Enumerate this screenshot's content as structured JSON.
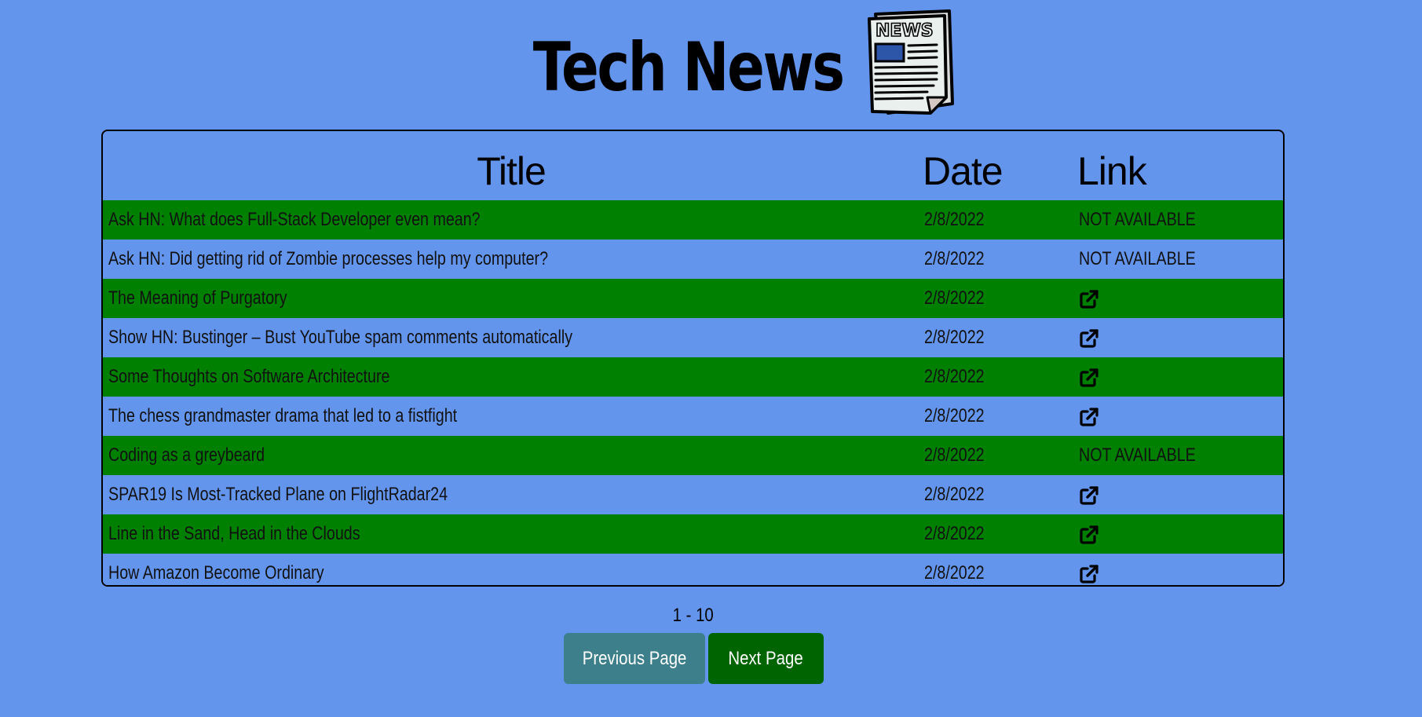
{
  "header": {
    "title": "Tech News",
    "logo_icon": "newspaper-icon",
    "logo_text": "NEWS"
  },
  "table": {
    "columns": {
      "title": "Title",
      "date": "Date",
      "link": "Link"
    },
    "not_available_text": "NOT AVAILABLE",
    "rows": [
      {
        "title": "Ask HN: What does Full-Stack Developer even mean?",
        "date": "2/8/2022",
        "link": "NOT AVAILABLE"
      },
      {
        "title": "Ask HN: Did getting rid of Zombie processes help my computer?",
        "date": "2/8/2022",
        "link": "NOT AVAILABLE"
      },
      {
        "title": "The Meaning of Purgatory",
        "date": "2/8/2022",
        "link": "external-link-icon"
      },
      {
        "title": "Show HN: Bustinger – Bust YouTube spam comments automatically",
        "date": "2/8/2022",
        "link": "external-link-icon"
      },
      {
        "title": "Some Thoughts on Software Architecture",
        "date": "2/8/2022",
        "link": "external-link-icon"
      },
      {
        "title": "The chess grandmaster drama that led to a fistfight",
        "date": "2/8/2022",
        "link": "external-link-icon"
      },
      {
        "title": "Coding as a greybeard",
        "date": "2/8/2022",
        "link": "NOT AVAILABLE"
      },
      {
        "title": "SPAR19 Is Most-Tracked Plane on FlightRadar24",
        "date": "2/8/2022",
        "link": "external-link-icon"
      },
      {
        "title": "Line in the Sand, Head in the Clouds",
        "date": "2/8/2022",
        "link": "external-link-icon"
      },
      {
        "title": "How Amazon Become Ordinary",
        "date": "2/8/2022",
        "link": "external-link-icon"
      }
    ]
  },
  "pagination": {
    "range": "1 - 10",
    "prev_label": "Previous Page",
    "next_label": "Next Page"
  },
  "colors": {
    "background": "#6495ed",
    "row_alt": "#008000",
    "prev_button": "#3d7f8a",
    "next_button": "#006400"
  }
}
